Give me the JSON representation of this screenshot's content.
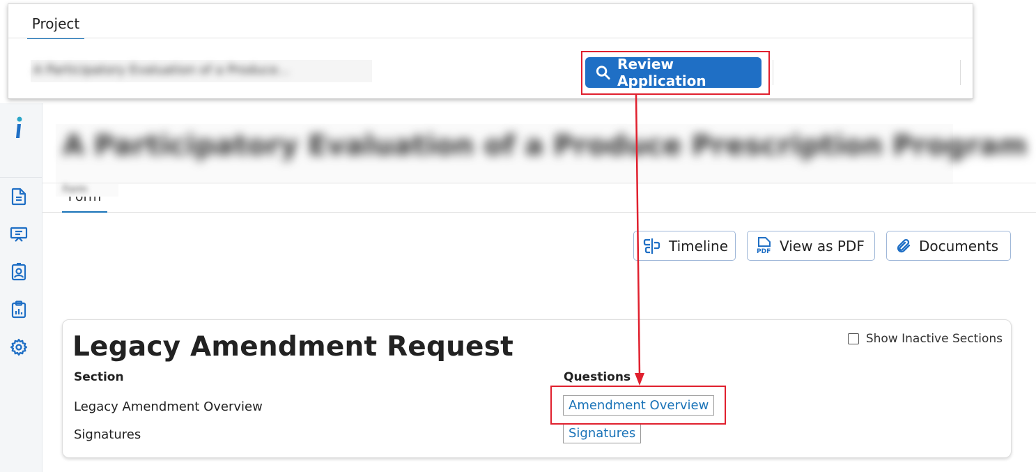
{
  "overlay": {
    "tab_label": "Project",
    "project_name_blurred": "A Participatory Evaluation of a Produce...",
    "review_button_label": "Review Application"
  },
  "page": {
    "title_blurred": "A Participatory Evaluation of a Produce Prescription Program",
    "subtitle_blurred": "Form",
    "form_tab_label": "Form"
  },
  "sidebar": {
    "logo": "i-logo",
    "items": [
      {
        "icon": "document-icon"
      },
      {
        "icon": "presentation-icon"
      },
      {
        "icon": "contact-badge-icon"
      },
      {
        "icon": "clipboard-chart-icon"
      },
      {
        "icon": "gear-icon"
      }
    ]
  },
  "toolbar": {
    "timeline_label": "Timeline",
    "pdf_label": "View as PDF",
    "documents_label": "Documents"
  },
  "card": {
    "title": "Legacy Amendment Request",
    "show_inactive_label": "Show Inactive Sections",
    "section_header": "Section",
    "questions_header": "Questions",
    "rows": [
      {
        "section": "Legacy Amendment Overview",
        "question": "Amendment Overview"
      },
      {
        "section": "Signatures",
        "question": "Signatures"
      }
    ]
  },
  "colors": {
    "primary": "#1f6fc5",
    "link": "#1a73b8",
    "annotation": "#e0202e"
  }
}
